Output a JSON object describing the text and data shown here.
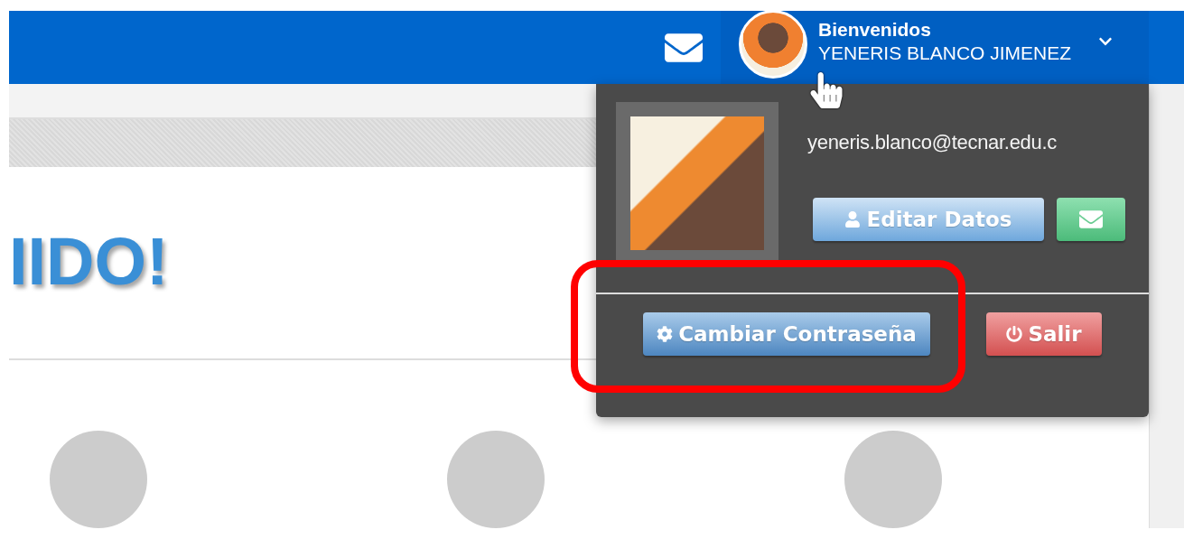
{
  "header": {
    "greeting": "Bienvenidos",
    "user_name": "YENERIS BLANCO JIMENEZ",
    "menu_expanded": true
  },
  "hero": {
    "heading": "IIDO!"
  },
  "user_menu": {
    "email": "yeneris.blanco@tecnar.edu.c",
    "top_buttons": [
      {
        "kind": "edit",
        "label": "Editar Datos"
      },
      {
        "kind": "mail"
      }
    ],
    "bottom_buttons": [
      {
        "kind": "password",
        "label": "Cambiar Contraseña",
        "highlighted": true
      },
      {
        "kind": "logout",
        "label": "Salir",
        "highlighted": false
      }
    ]
  }
}
